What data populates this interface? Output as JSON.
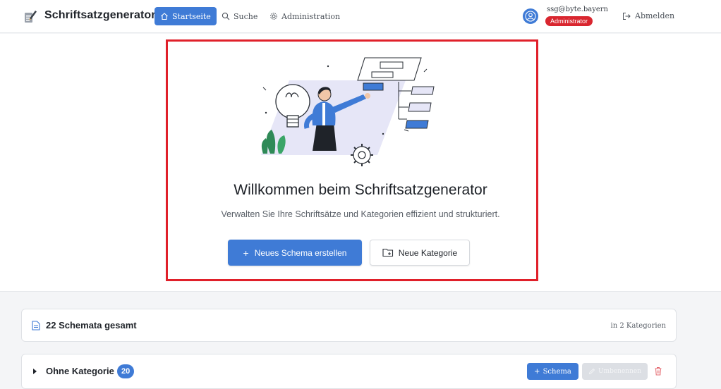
{
  "brand": {
    "title": "Schriftsatzgenerator"
  },
  "nav": {
    "home_label": "Startseite",
    "search_label": "Suche",
    "admin_label": "Administration"
  },
  "user": {
    "email": "ssg@byte.bayern",
    "role": "Administrator",
    "logout_label": "Abmelden"
  },
  "hero": {
    "title": "Willkommen beim Schriftsatzgenerator",
    "subtitle": "Verwalten Sie Ihre Schriftsätze und Kategorien effizient und strukturiert.",
    "new_schema_label": "Neues Schema erstellen",
    "new_category_label": "Neue Kategorie"
  },
  "summary": {
    "total_label": "22 Schemata gesamt",
    "categories_label": "in 2 Kategorien"
  },
  "category": {
    "name": "Ohne Kategorie",
    "count": "20",
    "add_schema_label": "Schema",
    "rename_label": "Umbenennen"
  },
  "colors": {
    "primary": "#3f7bd6",
    "danger": "#d9262f",
    "highlight_border": "#e0202a",
    "disabled": "#dcdfe4"
  }
}
